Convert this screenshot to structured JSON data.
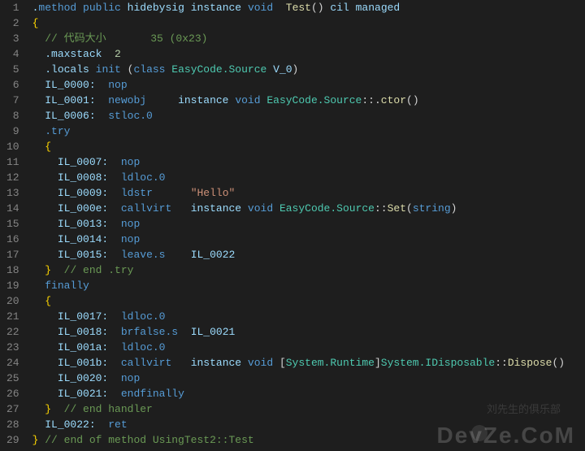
{
  "lines": [
    {
      "n": "1",
      "tokens": [
        {
          "t": ".",
          "c": "c-gray"
        },
        {
          "t": "method",
          "c": "c-blue"
        },
        {
          "t": " ",
          "c": ""
        },
        {
          "t": "public",
          "c": "c-blue"
        },
        {
          "t": " ",
          "c": ""
        },
        {
          "t": "hidebysig",
          "c": "c-gray"
        },
        {
          "t": " ",
          "c": ""
        },
        {
          "t": "instance",
          "c": "c-gray"
        },
        {
          "t": " ",
          "c": ""
        },
        {
          "t": "void",
          "c": "c-blue"
        },
        {
          "t": "  ",
          "c": ""
        },
        {
          "t": "Test",
          "c": "c-yellow"
        },
        {
          "t": "()",
          "c": "c-white"
        },
        {
          "t": " ",
          "c": ""
        },
        {
          "t": "cil managed",
          "c": "c-gray"
        }
      ]
    },
    {
      "n": "2",
      "tokens": [
        {
          "t": "{",
          "c": "c-brace"
        }
      ]
    },
    {
      "n": "3",
      "tokens": [
        {
          "t": "  ",
          "c": ""
        },
        {
          "t": "// 代码大小       35 (0x23)",
          "c": "c-green"
        }
      ]
    },
    {
      "n": "4",
      "tokens": [
        {
          "t": "  ",
          "c": ""
        },
        {
          "t": ".maxstack",
          "c": "c-gray"
        },
        {
          "t": "  ",
          "c": ""
        },
        {
          "t": "2",
          "c": "c-num"
        }
      ]
    },
    {
      "n": "5",
      "tokens": [
        {
          "t": "  ",
          "c": ""
        },
        {
          "t": ".locals",
          "c": "c-gray"
        },
        {
          "t": " ",
          "c": ""
        },
        {
          "t": "init",
          "c": "c-blue"
        },
        {
          "t": " (",
          "c": "c-white"
        },
        {
          "t": "class",
          "c": "c-blue"
        },
        {
          "t": " ",
          "c": ""
        },
        {
          "t": "EasyCode.Source",
          "c": "c-cyan"
        },
        {
          "t": " ",
          "c": ""
        },
        {
          "t": "V_0",
          "c": "c-gray"
        },
        {
          "t": ")",
          "c": "c-white"
        }
      ]
    },
    {
      "n": "6",
      "tokens": [
        {
          "t": "  ",
          "c": ""
        },
        {
          "t": "IL_0000:",
          "c": "c-gray"
        },
        {
          "t": "  ",
          "c": ""
        },
        {
          "t": "nop",
          "c": "c-blue"
        }
      ]
    },
    {
      "n": "7",
      "tokens": [
        {
          "t": "  ",
          "c": ""
        },
        {
          "t": "IL_0001:",
          "c": "c-gray"
        },
        {
          "t": "  ",
          "c": ""
        },
        {
          "t": "newobj",
          "c": "c-blue"
        },
        {
          "t": "     ",
          "c": ""
        },
        {
          "t": "instance",
          "c": "c-gray"
        },
        {
          "t": " ",
          "c": ""
        },
        {
          "t": "void",
          "c": "c-blue"
        },
        {
          "t": " ",
          "c": ""
        },
        {
          "t": "EasyCode.Source",
          "c": "c-cyan"
        },
        {
          "t": "::",
          "c": "c-white"
        },
        {
          "t": ".",
          "c": "c-white"
        },
        {
          "t": "ctor",
          "c": "c-yellow"
        },
        {
          "t": "()",
          "c": "c-white"
        }
      ]
    },
    {
      "n": "8",
      "tokens": [
        {
          "t": "  ",
          "c": ""
        },
        {
          "t": "IL_0006:",
          "c": "c-gray"
        },
        {
          "t": "  ",
          "c": ""
        },
        {
          "t": "stloc.0",
          "c": "c-blue"
        }
      ]
    },
    {
      "n": "9",
      "tokens": [
        {
          "t": "  ",
          "c": ""
        },
        {
          "t": ".try",
          "c": "c-blue"
        }
      ]
    },
    {
      "n": "10",
      "tokens": [
        {
          "t": "  ",
          "c": ""
        },
        {
          "t": "{",
          "c": "c-brace"
        }
      ]
    },
    {
      "n": "11",
      "tokens": [
        {
          "t": "    ",
          "c": ""
        },
        {
          "t": "IL_0007:",
          "c": "c-gray"
        },
        {
          "t": "  ",
          "c": ""
        },
        {
          "t": "nop",
          "c": "c-blue"
        }
      ]
    },
    {
      "n": "12",
      "tokens": [
        {
          "t": "    ",
          "c": ""
        },
        {
          "t": "IL_0008:",
          "c": "c-gray"
        },
        {
          "t": "  ",
          "c": ""
        },
        {
          "t": "ldloc.0",
          "c": "c-blue"
        }
      ]
    },
    {
      "n": "13",
      "tokens": [
        {
          "t": "    ",
          "c": ""
        },
        {
          "t": "IL_0009:",
          "c": "c-gray"
        },
        {
          "t": "  ",
          "c": ""
        },
        {
          "t": "ldstr",
          "c": "c-blue"
        },
        {
          "t": "      ",
          "c": ""
        },
        {
          "t": "\"Hello\"",
          "c": "c-orange"
        }
      ]
    },
    {
      "n": "14",
      "tokens": [
        {
          "t": "    ",
          "c": ""
        },
        {
          "t": "IL_000e:",
          "c": "c-gray"
        },
        {
          "t": "  ",
          "c": ""
        },
        {
          "t": "callvirt",
          "c": "c-blue"
        },
        {
          "t": "   ",
          "c": ""
        },
        {
          "t": "instance",
          "c": "c-gray"
        },
        {
          "t": " ",
          "c": ""
        },
        {
          "t": "void",
          "c": "c-blue"
        },
        {
          "t": " ",
          "c": ""
        },
        {
          "t": "EasyCode.Source",
          "c": "c-cyan"
        },
        {
          "t": "::",
          "c": "c-white"
        },
        {
          "t": "Set",
          "c": "c-yellow"
        },
        {
          "t": "(",
          "c": "c-white"
        },
        {
          "t": "string",
          "c": "c-blue"
        },
        {
          "t": ")",
          "c": "c-white"
        }
      ]
    },
    {
      "n": "15",
      "tokens": [
        {
          "t": "    ",
          "c": ""
        },
        {
          "t": "IL_0013:",
          "c": "c-gray"
        },
        {
          "t": "  ",
          "c": ""
        },
        {
          "t": "nop",
          "c": "c-blue"
        }
      ]
    },
    {
      "n": "16",
      "tokens": [
        {
          "t": "    ",
          "c": ""
        },
        {
          "t": "IL_0014:",
          "c": "c-gray"
        },
        {
          "t": "  ",
          "c": ""
        },
        {
          "t": "nop",
          "c": "c-blue"
        }
      ]
    },
    {
      "n": "17",
      "tokens": [
        {
          "t": "    ",
          "c": ""
        },
        {
          "t": "IL_0015:",
          "c": "c-gray"
        },
        {
          "t": "  ",
          "c": ""
        },
        {
          "t": "leave.s",
          "c": "c-blue"
        },
        {
          "t": "    ",
          "c": ""
        },
        {
          "t": "IL_0022",
          "c": "c-gray"
        }
      ]
    },
    {
      "n": "18",
      "tokens": [
        {
          "t": "  ",
          "c": ""
        },
        {
          "t": "}",
          "c": "c-brace"
        },
        {
          "t": "  ",
          "c": ""
        },
        {
          "t": "// end .try",
          "c": "c-green"
        }
      ]
    },
    {
      "n": "19",
      "tokens": [
        {
          "t": "  ",
          "c": ""
        },
        {
          "t": "finally",
          "c": "c-blue"
        }
      ]
    },
    {
      "n": "20",
      "tokens": [
        {
          "t": "  ",
          "c": ""
        },
        {
          "t": "{",
          "c": "c-brace"
        }
      ]
    },
    {
      "n": "21",
      "tokens": [
        {
          "t": "    ",
          "c": ""
        },
        {
          "t": "IL_0017:",
          "c": "c-gray"
        },
        {
          "t": "  ",
          "c": ""
        },
        {
          "t": "ldloc.0",
          "c": "c-blue"
        }
      ]
    },
    {
      "n": "22",
      "tokens": [
        {
          "t": "    ",
          "c": ""
        },
        {
          "t": "IL_0018:",
          "c": "c-gray"
        },
        {
          "t": "  ",
          "c": ""
        },
        {
          "t": "brfalse.s",
          "c": "c-blue"
        },
        {
          "t": "  ",
          "c": ""
        },
        {
          "t": "IL_0021",
          "c": "c-gray"
        }
      ]
    },
    {
      "n": "23",
      "tokens": [
        {
          "t": "    ",
          "c": ""
        },
        {
          "t": "IL_001a:",
          "c": "c-gray"
        },
        {
          "t": "  ",
          "c": ""
        },
        {
          "t": "ldloc.0",
          "c": "c-blue"
        }
      ]
    },
    {
      "n": "24",
      "tokens": [
        {
          "t": "    ",
          "c": ""
        },
        {
          "t": "IL_001b:",
          "c": "c-gray"
        },
        {
          "t": "  ",
          "c": ""
        },
        {
          "t": "callvirt",
          "c": "c-blue"
        },
        {
          "t": "   ",
          "c": ""
        },
        {
          "t": "instance",
          "c": "c-gray"
        },
        {
          "t": " ",
          "c": ""
        },
        {
          "t": "void",
          "c": "c-blue"
        },
        {
          "t": " [",
          "c": "c-white"
        },
        {
          "t": "System.Runtime",
          "c": "c-cyan"
        },
        {
          "t": "]",
          "c": "c-white"
        },
        {
          "t": "System.IDisposable",
          "c": "c-cyan"
        },
        {
          "t": "::",
          "c": "c-white"
        },
        {
          "t": "Dispose",
          "c": "c-yellow"
        },
        {
          "t": "()",
          "c": "c-white"
        }
      ]
    },
    {
      "n": "25",
      "tokens": [
        {
          "t": "    ",
          "c": ""
        },
        {
          "t": "IL_0020:",
          "c": "c-gray"
        },
        {
          "t": "  ",
          "c": ""
        },
        {
          "t": "nop",
          "c": "c-blue"
        }
      ]
    },
    {
      "n": "26",
      "tokens": [
        {
          "t": "    ",
          "c": ""
        },
        {
          "t": "IL_0021:",
          "c": "c-gray"
        },
        {
          "t": "  ",
          "c": ""
        },
        {
          "t": "endfinally",
          "c": "c-blue"
        }
      ]
    },
    {
      "n": "27",
      "tokens": [
        {
          "t": "  ",
          "c": ""
        },
        {
          "t": "}",
          "c": "c-brace"
        },
        {
          "t": "  ",
          "c": ""
        },
        {
          "t": "// end handler",
          "c": "c-green"
        }
      ]
    },
    {
      "n": "28",
      "tokens": [
        {
          "t": "  ",
          "c": ""
        },
        {
          "t": "IL_0022:",
          "c": "c-gray"
        },
        {
          "t": "  ",
          "c": ""
        },
        {
          "t": "ret",
          "c": "c-blue"
        }
      ]
    },
    {
      "n": "29",
      "tokens": [
        {
          "t": "}",
          "c": "c-brace"
        },
        {
          "t": " ",
          "c": ""
        },
        {
          "t": "// end of method UsingTest2::Test",
          "c": "c-green"
        }
      ]
    }
  ],
  "watermark": {
    "main": "DevZe.CoM",
    "sub": "刘先生的俱乐部"
  }
}
